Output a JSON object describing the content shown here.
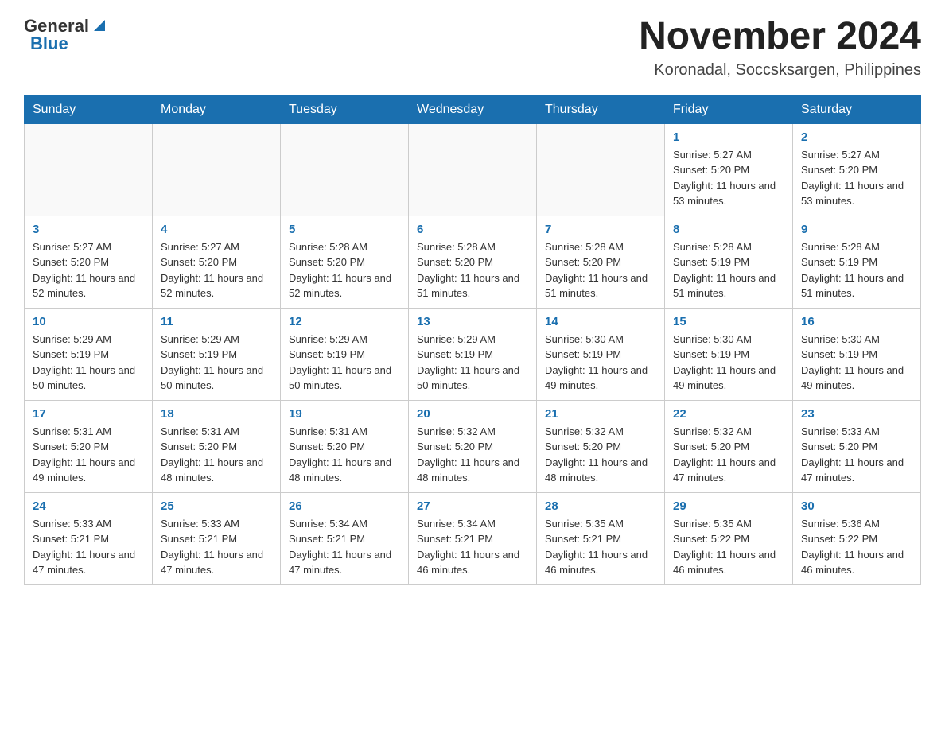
{
  "header": {
    "logo": {
      "general": "General",
      "blue": "Blue"
    },
    "title": "November 2024",
    "location": "Koronadal, Soccsksargen, Philippines"
  },
  "calendar": {
    "days_of_week": [
      "Sunday",
      "Monday",
      "Tuesday",
      "Wednesday",
      "Thursday",
      "Friday",
      "Saturday"
    ],
    "weeks": [
      [
        {
          "day": "",
          "info": ""
        },
        {
          "day": "",
          "info": ""
        },
        {
          "day": "",
          "info": ""
        },
        {
          "day": "",
          "info": ""
        },
        {
          "day": "",
          "info": ""
        },
        {
          "day": "1",
          "info": "Sunrise: 5:27 AM\nSunset: 5:20 PM\nDaylight: 11 hours and 53 minutes."
        },
        {
          "day": "2",
          "info": "Sunrise: 5:27 AM\nSunset: 5:20 PM\nDaylight: 11 hours and 53 minutes."
        }
      ],
      [
        {
          "day": "3",
          "info": "Sunrise: 5:27 AM\nSunset: 5:20 PM\nDaylight: 11 hours and 52 minutes."
        },
        {
          "day": "4",
          "info": "Sunrise: 5:27 AM\nSunset: 5:20 PM\nDaylight: 11 hours and 52 minutes."
        },
        {
          "day": "5",
          "info": "Sunrise: 5:28 AM\nSunset: 5:20 PM\nDaylight: 11 hours and 52 minutes."
        },
        {
          "day": "6",
          "info": "Sunrise: 5:28 AM\nSunset: 5:20 PM\nDaylight: 11 hours and 51 minutes."
        },
        {
          "day": "7",
          "info": "Sunrise: 5:28 AM\nSunset: 5:20 PM\nDaylight: 11 hours and 51 minutes."
        },
        {
          "day": "8",
          "info": "Sunrise: 5:28 AM\nSunset: 5:19 PM\nDaylight: 11 hours and 51 minutes."
        },
        {
          "day": "9",
          "info": "Sunrise: 5:28 AM\nSunset: 5:19 PM\nDaylight: 11 hours and 51 minutes."
        }
      ],
      [
        {
          "day": "10",
          "info": "Sunrise: 5:29 AM\nSunset: 5:19 PM\nDaylight: 11 hours and 50 minutes."
        },
        {
          "day": "11",
          "info": "Sunrise: 5:29 AM\nSunset: 5:19 PM\nDaylight: 11 hours and 50 minutes."
        },
        {
          "day": "12",
          "info": "Sunrise: 5:29 AM\nSunset: 5:19 PM\nDaylight: 11 hours and 50 minutes."
        },
        {
          "day": "13",
          "info": "Sunrise: 5:29 AM\nSunset: 5:19 PM\nDaylight: 11 hours and 50 minutes."
        },
        {
          "day": "14",
          "info": "Sunrise: 5:30 AM\nSunset: 5:19 PM\nDaylight: 11 hours and 49 minutes."
        },
        {
          "day": "15",
          "info": "Sunrise: 5:30 AM\nSunset: 5:19 PM\nDaylight: 11 hours and 49 minutes."
        },
        {
          "day": "16",
          "info": "Sunrise: 5:30 AM\nSunset: 5:19 PM\nDaylight: 11 hours and 49 minutes."
        }
      ],
      [
        {
          "day": "17",
          "info": "Sunrise: 5:31 AM\nSunset: 5:20 PM\nDaylight: 11 hours and 49 minutes."
        },
        {
          "day": "18",
          "info": "Sunrise: 5:31 AM\nSunset: 5:20 PM\nDaylight: 11 hours and 48 minutes."
        },
        {
          "day": "19",
          "info": "Sunrise: 5:31 AM\nSunset: 5:20 PM\nDaylight: 11 hours and 48 minutes."
        },
        {
          "day": "20",
          "info": "Sunrise: 5:32 AM\nSunset: 5:20 PM\nDaylight: 11 hours and 48 minutes."
        },
        {
          "day": "21",
          "info": "Sunrise: 5:32 AM\nSunset: 5:20 PM\nDaylight: 11 hours and 48 minutes."
        },
        {
          "day": "22",
          "info": "Sunrise: 5:32 AM\nSunset: 5:20 PM\nDaylight: 11 hours and 47 minutes."
        },
        {
          "day": "23",
          "info": "Sunrise: 5:33 AM\nSunset: 5:20 PM\nDaylight: 11 hours and 47 minutes."
        }
      ],
      [
        {
          "day": "24",
          "info": "Sunrise: 5:33 AM\nSunset: 5:21 PM\nDaylight: 11 hours and 47 minutes."
        },
        {
          "day": "25",
          "info": "Sunrise: 5:33 AM\nSunset: 5:21 PM\nDaylight: 11 hours and 47 minutes."
        },
        {
          "day": "26",
          "info": "Sunrise: 5:34 AM\nSunset: 5:21 PM\nDaylight: 11 hours and 47 minutes."
        },
        {
          "day": "27",
          "info": "Sunrise: 5:34 AM\nSunset: 5:21 PM\nDaylight: 11 hours and 46 minutes."
        },
        {
          "day": "28",
          "info": "Sunrise: 5:35 AM\nSunset: 5:21 PM\nDaylight: 11 hours and 46 minutes."
        },
        {
          "day": "29",
          "info": "Sunrise: 5:35 AM\nSunset: 5:22 PM\nDaylight: 11 hours and 46 minutes."
        },
        {
          "day": "30",
          "info": "Sunrise: 5:36 AM\nSunset: 5:22 PM\nDaylight: 11 hours and 46 minutes."
        }
      ]
    ]
  }
}
